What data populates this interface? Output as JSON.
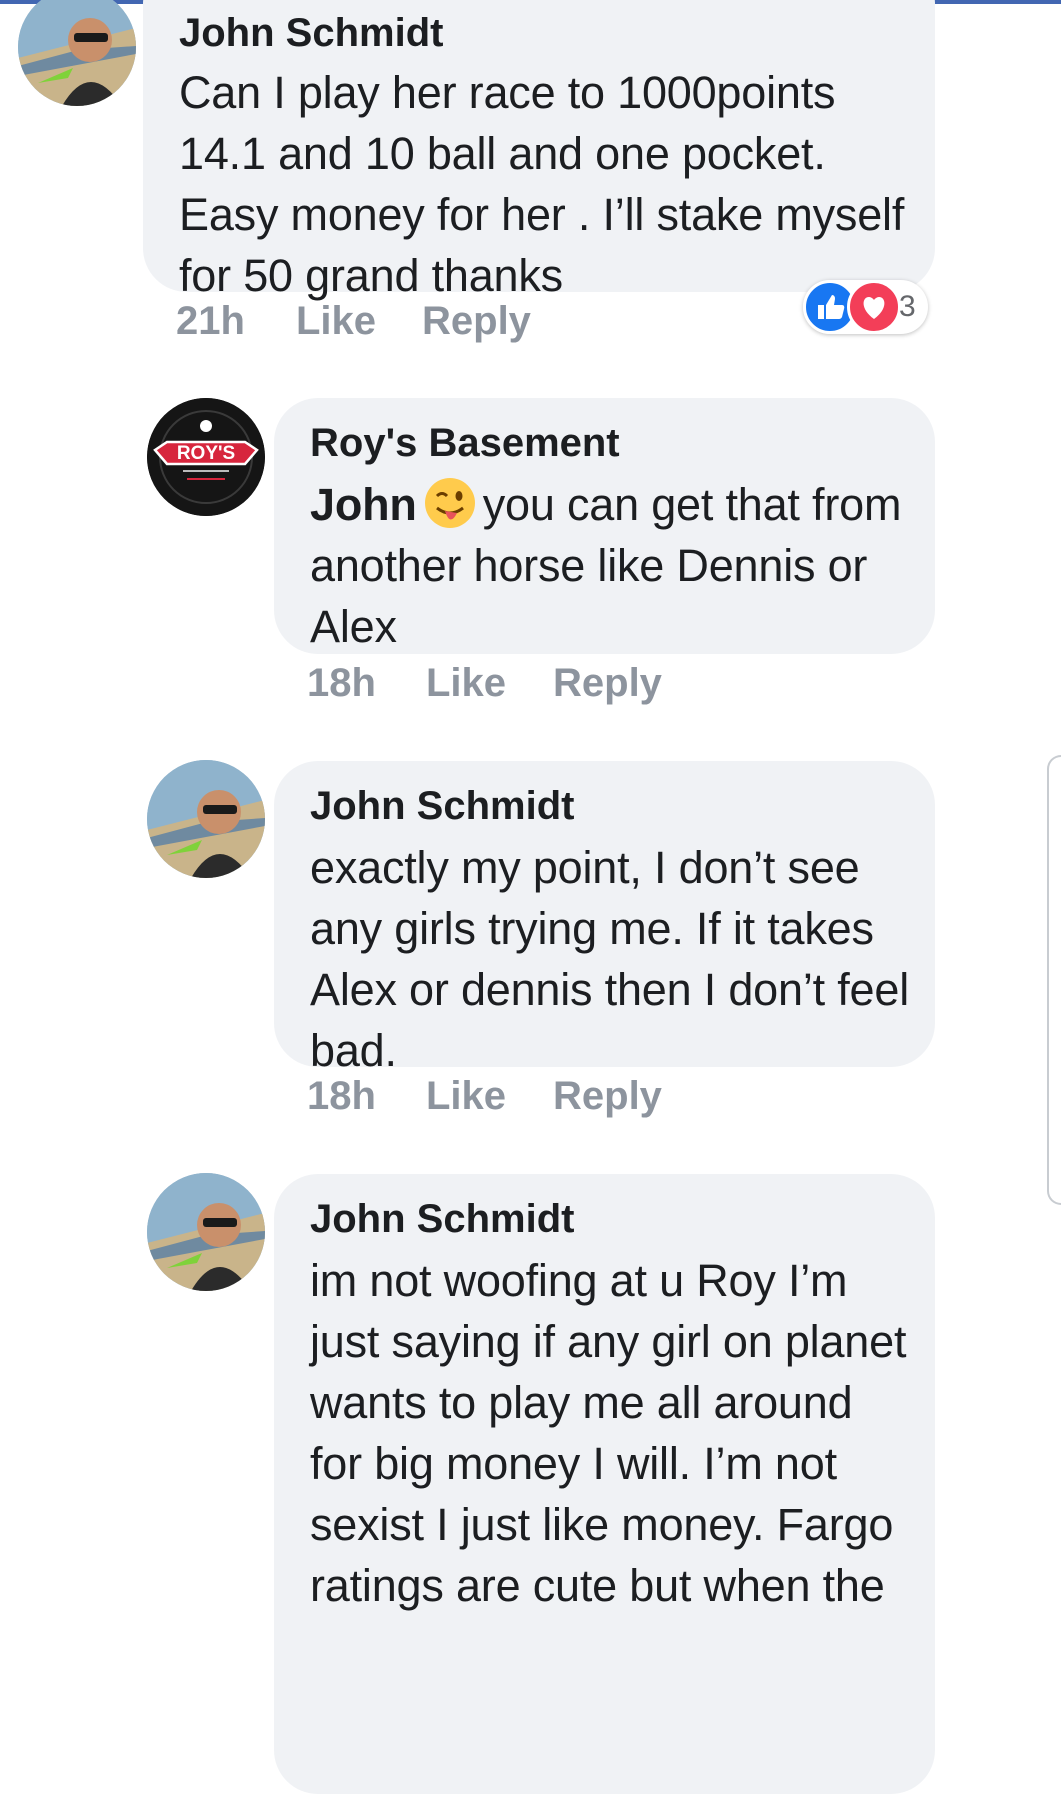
{
  "comments": [
    {
      "author": "John Schmidt",
      "text": "Can I play her race to 1000points 14.1 and 10 ball and one pocket. Easy money for her . I’ll stake myself for 50 grand thanks",
      "time": "21h",
      "like_label": "Like",
      "reply_label": "Reply",
      "reaction_count": "3"
    },
    {
      "author": "Roy's Basement",
      "tag": "John",
      "emoji": "winking-face-with-tongue",
      "text": "you can get that from another horse like Dennis or Alex",
      "time": "18h",
      "like_label": "Like",
      "reply_label": "Reply",
      "logo_text": "ROY'S"
    },
    {
      "author": "John Schmidt",
      "text": "exactly my point, I don’t see any girls trying me. If it takes Alex or dennis then I don’t feel bad.",
      "time": "18h",
      "like_label": "Like",
      "reply_label": "Reply"
    },
    {
      "author": "John Schmidt",
      "text": "im not woofing at u Roy I’m just saying if any girl on planet wants to play me all around for big money I will. I’m not sexist I just like money. Fargo ratings are cute but when the"
    }
  ],
  "colors": {
    "bubble": "#f0f2f5",
    "meta_text": "#8d949e",
    "like_blue": "#1877f2",
    "love_red": "#f33e58",
    "top_bar": "#4267b2"
  }
}
